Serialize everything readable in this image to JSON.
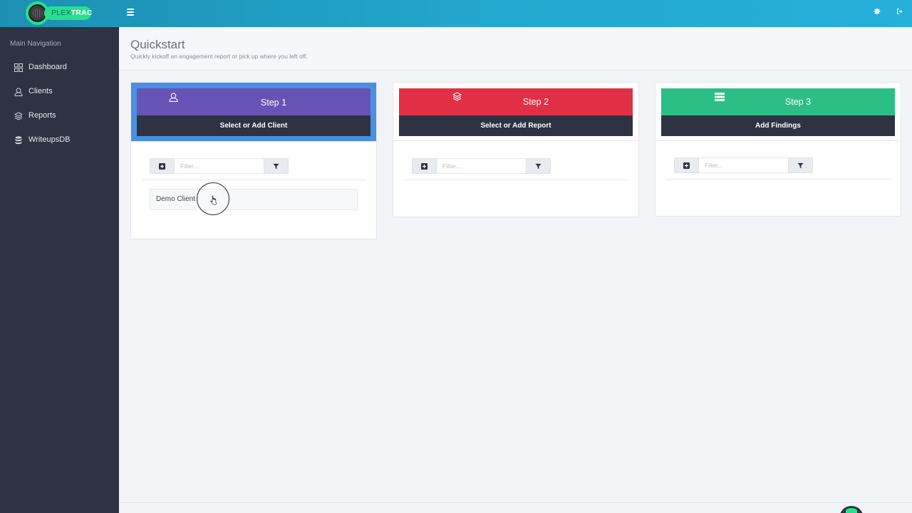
{
  "app": {
    "logo_text_light": "PLEX",
    "logo_text_bold": "TRAC",
    "brand_color": "#27e08e",
    "topbar_color": "#22a6cc"
  },
  "topbar": {
    "menu_icon": "hamburger-menu-icon",
    "settings_icon": "gear-icon",
    "logout_icon": "logout-icon"
  },
  "sidebar": {
    "heading": "Main Navigation",
    "items": [
      {
        "label": "Dashboard",
        "icon": "dashboard-grid-icon"
      },
      {
        "label": "Clients",
        "icon": "user-icon"
      },
      {
        "label": "Reports",
        "icon": "layers-icon"
      },
      {
        "label": "WriteupsDB",
        "icon": "database-icon"
      }
    ]
  },
  "page": {
    "title": "Quickstart",
    "subtitle": "Quickly kickoff an engagement report or pick up where you left off."
  },
  "steps": [
    {
      "label": "Step 1",
      "action": "Select or Add Client",
      "color": "#6554b5",
      "icon": "user-icon",
      "filter_placeholder": "Filter...",
      "items": [
        "Demo Client"
      ]
    },
    {
      "label": "Step 2",
      "action": "Select or Add Report",
      "color": "#e12f45",
      "icon": "layers-icon",
      "filter_placeholder": "Filter...",
      "items": []
    },
    {
      "label": "Step 3",
      "action": "Add Findings",
      "color": "#2bbf85",
      "icon": "list-icon",
      "filter_placeholder": "Filter...",
      "items": []
    }
  ]
}
